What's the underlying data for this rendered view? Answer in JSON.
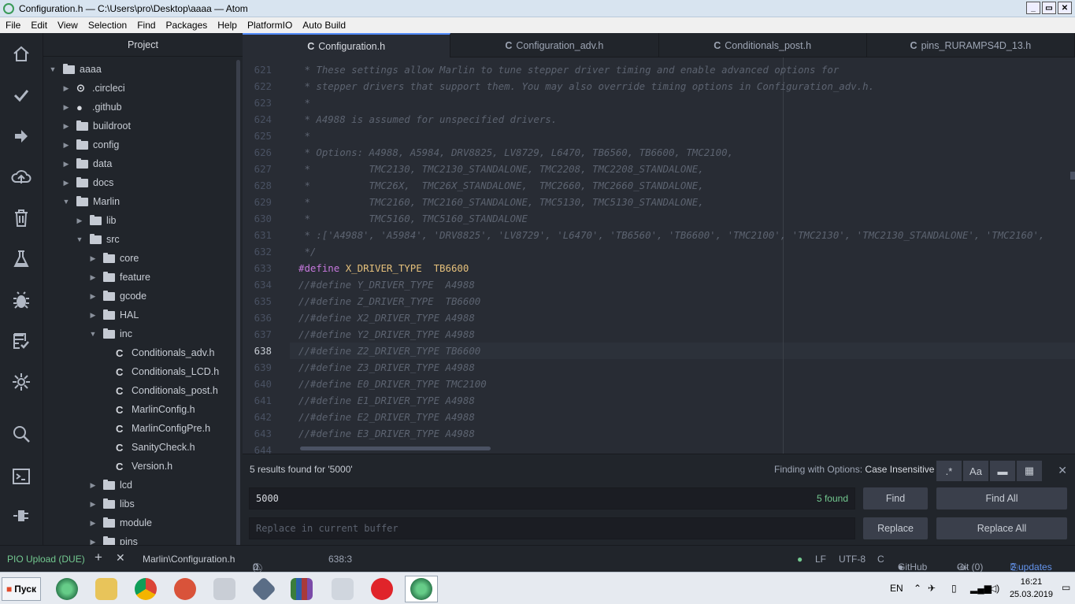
{
  "window": {
    "title": "Configuration.h — C:\\Users\\pro\\Desktop\\aaaa — Atom"
  },
  "menu": [
    "File",
    "Edit",
    "View",
    "Selection",
    "Find",
    "Packages",
    "Help",
    "PlatformIO",
    "Auto Build"
  ],
  "sidebar_icons": [
    "home-icon",
    "check-icon",
    "arrow-right-icon",
    "cloud-upload-icon",
    "trash-icon",
    "flask-icon",
    "bug-icon",
    "checklist-icon",
    "plug-star-icon",
    "search-icon",
    "terminal-icon",
    "plug-icon"
  ],
  "tree": {
    "header": "Project",
    "items": [
      {
        "label": "aaaa",
        "type": "folder",
        "depth": 0,
        "open": true
      },
      {
        "label": ".circleci",
        "type": "special",
        "depth": 1,
        "open": false
      },
      {
        "label": ".github",
        "type": "github",
        "depth": 1,
        "open": false
      },
      {
        "label": "buildroot",
        "type": "folder",
        "depth": 1,
        "open": false
      },
      {
        "label": "config",
        "type": "folder",
        "depth": 1,
        "open": false
      },
      {
        "label": "data",
        "type": "folder",
        "depth": 1,
        "open": false
      },
      {
        "label": "docs",
        "type": "folder",
        "depth": 1,
        "open": false
      },
      {
        "label": "Marlin",
        "type": "folder",
        "depth": 1,
        "open": true
      },
      {
        "label": "lib",
        "type": "folder",
        "depth": 2,
        "open": false
      },
      {
        "label": "src",
        "type": "folder",
        "depth": 2,
        "open": true
      },
      {
        "label": "core",
        "type": "folder",
        "depth": 3,
        "open": false
      },
      {
        "label": "feature",
        "type": "folder",
        "depth": 3,
        "open": false
      },
      {
        "label": "gcode",
        "type": "folder",
        "depth": 3,
        "open": false
      },
      {
        "label": "HAL",
        "type": "folder",
        "depth": 3,
        "open": false
      },
      {
        "label": "inc",
        "type": "folder",
        "depth": 3,
        "open": true
      },
      {
        "label": "Conditionals_adv.h",
        "type": "file",
        "depth": 4
      },
      {
        "label": "Conditionals_LCD.h",
        "type": "file",
        "depth": 4
      },
      {
        "label": "Conditionals_post.h",
        "type": "file",
        "depth": 4
      },
      {
        "label": "MarlinConfig.h",
        "type": "file",
        "depth": 4
      },
      {
        "label": "MarlinConfigPre.h",
        "type": "file",
        "depth": 4
      },
      {
        "label": "SanityCheck.h",
        "type": "file",
        "depth": 4
      },
      {
        "label": "Version.h",
        "type": "file",
        "depth": 4
      },
      {
        "label": "lcd",
        "type": "folder",
        "depth": 3,
        "open": false
      },
      {
        "label": "libs",
        "type": "folder",
        "depth": 3,
        "open": false
      },
      {
        "label": "module",
        "type": "folder",
        "depth": 3,
        "open": false
      },
      {
        "label": "pins",
        "type": "folder",
        "depth": 3,
        "open": false
      }
    ]
  },
  "tabs": [
    {
      "label": "Configuration.h",
      "active": true
    },
    {
      "label": "Configuration_adv.h",
      "active": false
    },
    {
      "label": "Conditionals_post.h",
      "active": false
    },
    {
      "label": "pins_RURAMPS4D_13.h",
      "active": false
    }
  ],
  "editor": {
    "current_line": "638",
    "lines": [
      {
        "n": "621",
        "text": " * These settings allow Marlin to tune stepper driver timing and enable advanced options for"
      },
      {
        "n": "622",
        "text": " * stepper drivers that support them. You may also override timing options in Configuration_adv.h."
      },
      {
        "n": "623",
        "text": " *"
      },
      {
        "n": "624",
        "text": " * A4988 is assumed for unspecified drivers."
      },
      {
        "n": "625",
        "text": " *"
      },
      {
        "n": "626",
        "text": " * Options: A4988, A5984, DRV8825, LV8729, L6470, TB6560, TB6600, TMC2100,"
      },
      {
        "n": "627",
        "text": " *          TMC2130, TMC2130_STANDALONE, TMC2208, TMC2208_STANDALONE,"
      },
      {
        "n": "628",
        "text": " *          TMC26X,  TMC26X_STANDALONE,  TMC2660, TMC2660_STANDALONE,"
      },
      {
        "n": "629",
        "text": " *          TMC2160, TMC2160_STANDALONE, TMC5130, TMC5130_STANDALONE,"
      },
      {
        "n": "630",
        "text": " *          TMC5160, TMC5160_STANDALONE"
      },
      {
        "n": "631",
        "text": " * :['A4988', 'A5984', 'DRV8825', 'LV8729', 'L6470', 'TB6560', 'TB6600', 'TMC2100', 'TMC2130', 'TMC2130_STANDALONE', 'TMC2160',"
      },
      {
        "n": "632",
        "text": " */"
      },
      {
        "n": "633",
        "text": "#define X_DRIVER_TYPE  TB6600",
        "define": true
      },
      {
        "n": "634",
        "text": "//#define Y_DRIVER_TYPE  A4988"
      },
      {
        "n": "635",
        "text": "//#define Z_DRIVER_TYPE  TB6600"
      },
      {
        "n": "636",
        "text": "//#define X2_DRIVER_TYPE A4988"
      },
      {
        "n": "637",
        "text": "//#define Y2_DRIVER_TYPE A4988"
      },
      {
        "n": "638",
        "text": "//#define Z2_DRIVER_TYPE TB6600"
      },
      {
        "n": "639",
        "text": "//#define Z3_DRIVER_TYPE A4988"
      },
      {
        "n": "640",
        "text": "//#define E0_DRIVER_TYPE TMC2100"
      },
      {
        "n": "641",
        "text": "//#define E1_DRIVER_TYPE A4988"
      },
      {
        "n": "642",
        "text": "//#define E2_DRIVER_TYPE A4988"
      },
      {
        "n": "643",
        "text": "//#define E3_DRIVER_TYPE A4988"
      },
      {
        "n": "644",
        "text": ""
      }
    ]
  },
  "find": {
    "description": "5 results found for '5000'",
    "options_label": "Finding with Options:",
    "options_value": "Case Insensitive",
    "option_buttons": [
      ".*",
      "Aa",
      "▬",
      "▦"
    ],
    "query": "5000",
    "count": "5 found",
    "replace_placeholder": "Replace in current buffer",
    "find_label": "Find",
    "find_all_label": "Find All",
    "replace_label": "Replace",
    "replace_all_label": "Replace All",
    "close": "✕"
  },
  "status": {
    "pio_upload": "PIO Upload (DUE)",
    "file_path": "Marlin\\Configuration.h",
    "errors": "0",
    "warnings": "0",
    "infos": "0",
    "cursor": "638:3",
    "line_ending": "LF",
    "encoding": "UTF-8",
    "grammar": "C",
    "github": "GitHub",
    "git": "Git (0)",
    "updates": "2 updates"
  },
  "taskbar": {
    "start": "Пуск",
    "lang": "EN",
    "time": "16:21",
    "date": "25.03.2019",
    "apps": [
      "atom",
      "explorer",
      "chrome",
      "ccleaner",
      "calculator",
      "app-cube",
      "books",
      "scissors",
      "tp-app",
      "atom-active"
    ]
  },
  "colors": {
    "accent": "#528bff",
    "editor_bg": "#282c34",
    "panel_bg": "#21252b",
    "found": "#73c990",
    "updates": "#6494ed",
    "status_green": "#73c990"
  }
}
